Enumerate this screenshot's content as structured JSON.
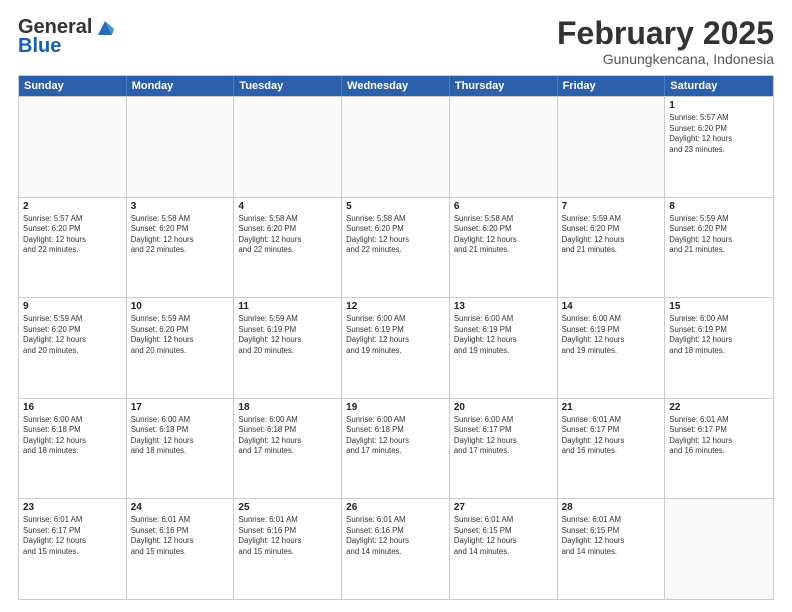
{
  "logo": {
    "general": "General",
    "blue": "Blue"
  },
  "header": {
    "month": "February 2025",
    "location": "Gunungkencana, Indonesia"
  },
  "weekdays": [
    "Sunday",
    "Monday",
    "Tuesday",
    "Wednesday",
    "Thursday",
    "Friday",
    "Saturday"
  ],
  "rows": [
    [
      {
        "day": "",
        "info": ""
      },
      {
        "day": "",
        "info": ""
      },
      {
        "day": "",
        "info": ""
      },
      {
        "day": "",
        "info": ""
      },
      {
        "day": "",
        "info": ""
      },
      {
        "day": "",
        "info": ""
      },
      {
        "day": "1",
        "info": "Sunrise: 5:57 AM\nSunset: 6:20 PM\nDaylight: 12 hours\nand 23 minutes."
      }
    ],
    [
      {
        "day": "2",
        "info": "Sunrise: 5:57 AM\nSunset: 6:20 PM\nDaylight: 12 hours\nand 22 minutes."
      },
      {
        "day": "3",
        "info": "Sunrise: 5:58 AM\nSunset: 6:20 PM\nDaylight: 12 hours\nand 22 minutes."
      },
      {
        "day": "4",
        "info": "Sunrise: 5:58 AM\nSunset: 6:20 PM\nDaylight: 12 hours\nand 22 minutes."
      },
      {
        "day": "5",
        "info": "Sunrise: 5:58 AM\nSunset: 6:20 PM\nDaylight: 12 hours\nand 22 minutes."
      },
      {
        "day": "6",
        "info": "Sunrise: 5:58 AM\nSunset: 6:20 PM\nDaylight: 12 hours\nand 21 minutes."
      },
      {
        "day": "7",
        "info": "Sunrise: 5:59 AM\nSunset: 6:20 PM\nDaylight: 12 hours\nand 21 minutes."
      },
      {
        "day": "8",
        "info": "Sunrise: 5:59 AM\nSunset: 6:20 PM\nDaylight: 12 hours\nand 21 minutes."
      }
    ],
    [
      {
        "day": "9",
        "info": "Sunrise: 5:59 AM\nSunset: 6:20 PM\nDaylight: 12 hours\nand 20 minutes."
      },
      {
        "day": "10",
        "info": "Sunrise: 5:59 AM\nSunset: 6:20 PM\nDaylight: 12 hours\nand 20 minutes."
      },
      {
        "day": "11",
        "info": "Sunrise: 5:59 AM\nSunset: 6:19 PM\nDaylight: 12 hours\nand 20 minutes."
      },
      {
        "day": "12",
        "info": "Sunrise: 6:00 AM\nSunset: 6:19 PM\nDaylight: 12 hours\nand 19 minutes."
      },
      {
        "day": "13",
        "info": "Sunrise: 6:00 AM\nSunset: 6:19 PM\nDaylight: 12 hours\nand 19 minutes."
      },
      {
        "day": "14",
        "info": "Sunrise: 6:00 AM\nSunset: 6:19 PM\nDaylight: 12 hours\nand 19 minutes."
      },
      {
        "day": "15",
        "info": "Sunrise: 6:00 AM\nSunset: 6:19 PM\nDaylight: 12 hours\nand 18 minutes."
      }
    ],
    [
      {
        "day": "16",
        "info": "Sunrise: 6:00 AM\nSunset: 6:18 PM\nDaylight: 12 hours\nand 18 minutes."
      },
      {
        "day": "17",
        "info": "Sunrise: 6:00 AM\nSunset: 6:18 PM\nDaylight: 12 hours\nand 18 minutes."
      },
      {
        "day": "18",
        "info": "Sunrise: 6:00 AM\nSunset: 6:18 PM\nDaylight: 12 hours\nand 17 minutes."
      },
      {
        "day": "19",
        "info": "Sunrise: 6:00 AM\nSunset: 6:18 PM\nDaylight: 12 hours\nand 17 minutes."
      },
      {
        "day": "20",
        "info": "Sunrise: 6:00 AM\nSunset: 6:17 PM\nDaylight: 12 hours\nand 17 minutes."
      },
      {
        "day": "21",
        "info": "Sunrise: 6:01 AM\nSunset: 6:17 PM\nDaylight: 12 hours\nand 16 minutes."
      },
      {
        "day": "22",
        "info": "Sunrise: 6:01 AM\nSunset: 6:17 PM\nDaylight: 12 hours\nand 16 minutes."
      }
    ],
    [
      {
        "day": "23",
        "info": "Sunrise: 6:01 AM\nSunset: 6:17 PM\nDaylight: 12 hours\nand 15 minutes."
      },
      {
        "day": "24",
        "info": "Sunrise: 6:01 AM\nSunset: 6:16 PM\nDaylight: 12 hours\nand 15 minutes."
      },
      {
        "day": "25",
        "info": "Sunrise: 6:01 AM\nSunset: 6:16 PM\nDaylight: 12 hours\nand 15 minutes."
      },
      {
        "day": "26",
        "info": "Sunrise: 6:01 AM\nSunset: 6:16 PM\nDaylight: 12 hours\nand 14 minutes."
      },
      {
        "day": "27",
        "info": "Sunrise: 6:01 AM\nSunset: 6:15 PM\nDaylight: 12 hours\nand 14 minutes."
      },
      {
        "day": "28",
        "info": "Sunrise: 6:01 AM\nSunset: 6:15 PM\nDaylight: 12 hours\nand 14 minutes."
      },
      {
        "day": "",
        "info": ""
      }
    ]
  ]
}
